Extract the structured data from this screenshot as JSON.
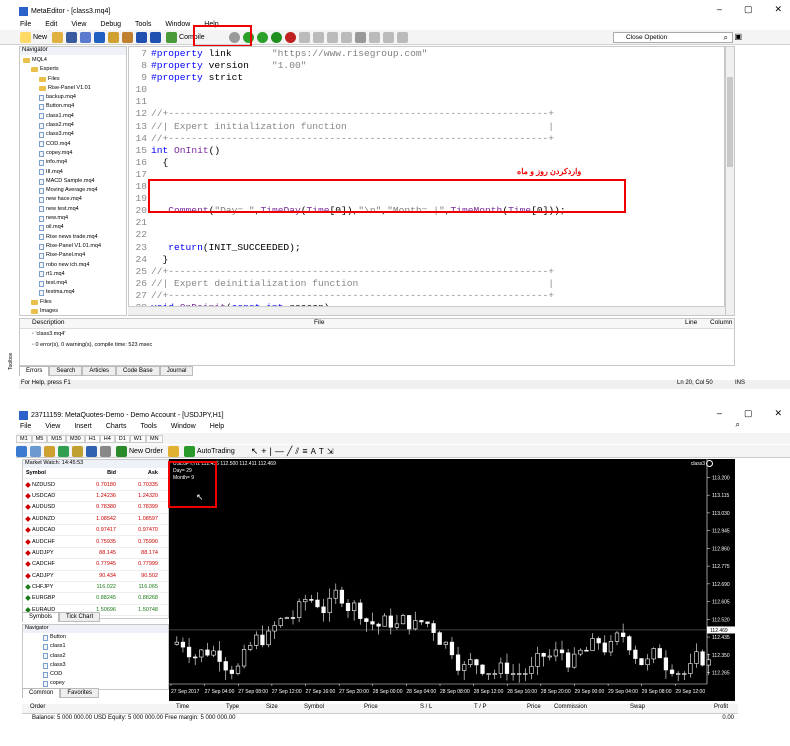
{
  "editor": {
    "title": "MetaEditor - [class3.mq4]",
    "menu": [
      "File",
      "Edit",
      "View",
      "Debug",
      "Tools",
      "Window",
      "Help"
    ],
    "toolbar": {
      "new_label": "New",
      "compile_label": "Compile",
      "search_value": "Close Opetion"
    },
    "navigator": {
      "header": "Navigator",
      "items": [
        {
          "label": "MQL4",
          "type": "folder",
          "indent": 0
        },
        {
          "label": "Experts",
          "type": "folder",
          "indent": 1
        },
        {
          "label": "Files",
          "type": "folder",
          "indent": 2
        },
        {
          "label": "Rise-Panel V1.01",
          "type": "folder",
          "indent": 2
        },
        {
          "label": "backup.mq4",
          "type": "file",
          "indent": 2
        },
        {
          "label": "Button.mq4",
          "type": "file",
          "indent": 2
        },
        {
          "label": "class1.mq4",
          "type": "file",
          "indent": 2
        },
        {
          "label": "class2.mq4",
          "type": "file",
          "indent": 2
        },
        {
          "label": "class3.mq4",
          "type": "file",
          "indent": 2
        },
        {
          "label": "COD.mq4",
          "type": "file",
          "indent": 2
        },
        {
          "label": "copey.mq4",
          "type": "file",
          "indent": 2
        },
        {
          "label": "info.mq4",
          "type": "file",
          "indent": 2
        },
        {
          "label": "III.mq4",
          "type": "file",
          "indent": 2
        },
        {
          "label": "MACD Sample.mq4",
          "type": "file",
          "indent": 2
        },
        {
          "label": "Moving Average.mq4",
          "type": "file",
          "indent": 2
        },
        {
          "label": "new hace.mq4",
          "type": "file",
          "indent": 2
        },
        {
          "label": "new test.mq4",
          "type": "file",
          "indent": 2
        },
        {
          "label": "new.mq4",
          "type": "file",
          "indent": 2
        },
        {
          "label": "oil.mq4",
          "type": "file",
          "indent": 2
        },
        {
          "label": "Rise news trade.mq4",
          "type": "file",
          "indent": 2
        },
        {
          "label": "Rise-Panel V1.01.mq4",
          "type": "file",
          "indent": 2
        },
        {
          "label": "Rise-Panel.mq4",
          "type": "file",
          "indent": 2
        },
        {
          "label": "robo new ich.mq4",
          "type": "file",
          "indent": 2
        },
        {
          "label": "rt1.mq4",
          "type": "file",
          "indent": 2
        },
        {
          "label": "test.mq4",
          "type": "file",
          "indent": 2
        },
        {
          "label": "testma.mq4",
          "type": "file",
          "indent": 2
        },
        {
          "label": "Files",
          "type": "folder",
          "indent": 1
        },
        {
          "label": "Images",
          "type": "folder",
          "indent": 1
        }
      ]
    },
    "code_lines": [
      {
        "n": "7",
        "html": "<span class='kw'>#property</span> link       <span class='st'>\"https://www.risegroup.com\"</span>"
      },
      {
        "n": "8",
        "html": "<span class='kw'>#property</span> version    <span class='st'>\"1.00\"</span>"
      },
      {
        "n": "9",
        "html": "<span class='kw'>#property</span> strict"
      },
      {
        "n": "10",
        "html": ""
      },
      {
        "n": "11",
        "html": ""
      },
      {
        "n": "12",
        "html": "<span class='cm'>//+------------------------------------------------------------------+</span>"
      },
      {
        "n": "13",
        "html": "<span class='cm'>//| Expert initialization function                                   |</span>"
      },
      {
        "n": "14",
        "html": "<span class='cm'>//+------------------------------------------------------------------+</span>"
      },
      {
        "n": "15",
        "html": "<span class='kw'>int</span> <span class='fn'>OnInit</span>()"
      },
      {
        "n": "16",
        "html": "  {"
      },
      {
        "n": "17",
        "html": ""
      },
      {
        "n": "18",
        "html": ""
      },
      {
        "n": "19",
        "html": ""
      },
      {
        "n": "20",
        "html": "   <span class='fn'>Comment</span>(<span class='st'>\"Day= \"</span>,<span class='fn'>TimeDay</span>(<span class='fn'>Time</span>[0]),<span class='st'>\"\\n\"</span>,<span class='st'>\"Month= |\"</span>,<span class='fn'>TimeMonth</span>(<span class='fn'>Time</span>[0]));"
      },
      {
        "n": "21",
        "html": ""
      },
      {
        "n": "22",
        "html": ""
      },
      {
        "n": "23",
        "html": "   <span class='kw'>return</span>(INIT_SUCCEEDED);"
      },
      {
        "n": "24",
        "html": "  }"
      },
      {
        "n": "25",
        "html": "<span class='cm'>//+------------------------------------------------------------------+</span>"
      },
      {
        "n": "26",
        "html": "<span class='cm'>//| Expert deinitialization function                                 |</span>"
      },
      {
        "n": "27",
        "html": "<span class='cm'>//+------------------------------------------------------------------+</span>"
      },
      {
        "n": "28",
        "html": "<span class='kw'>void</span> <span class='fn'>OnDeinit</span>(<span class='kw'>const int</span> reason)"
      },
      {
        "n": "29",
        "html": "  {"
      },
      {
        "n": "30",
        "html": "<span class='cm'>//---</span>"
      }
    ],
    "annotation_fa": "واردکردن روز و ماه",
    "errors_panel": {
      "col_description": "Description",
      "col_file": "File",
      "col_line": "Line",
      "col_column": "Column",
      "rows": [
        "'class3.mq4'",
        "0 error(s), 0 warning(s), compile time: 523 msec"
      ],
      "tabs": [
        "Errors",
        "Search",
        "Articles",
        "Code Base",
        "Journal"
      ],
      "side_label": "Toolbox"
    },
    "status": {
      "left": "For Help, press F1",
      "pos": "Ln 20, Col 50",
      "ins": "INS"
    }
  },
  "terminal": {
    "title": "23711159: MetaQuotes-Demo - Demo Account - [USDJPY,H1]",
    "menu": [
      "File",
      "View",
      "Insert",
      "Charts",
      "Tools",
      "Window",
      "Help"
    ],
    "timeframes": [
      "M1",
      "M5",
      "M15",
      "M30",
      "H1",
      "H4",
      "D1",
      "W1",
      "MN"
    ],
    "toolbar": {
      "new_order": "New Order",
      "autotrading": "AutoTrading"
    },
    "market_watch": {
      "header": "Market Watch: 14:45:53",
      "cols": [
        "Symbol",
        "Bid",
        "Ask"
      ],
      "rows": [
        {
          "s": "NZDUSD",
          "b": "0.70180",
          "a": "0.70335",
          "c": "#c00"
        },
        {
          "s": "USDCAD",
          "b": "1.24236",
          "a": "1.24320",
          "c": "#c00"
        },
        {
          "s": "AUDUSD",
          "b": "0.78380",
          "a": "0.78399",
          "c": "#c00"
        },
        {
          "s": "AUDNZD",
          "b": "1.08542",
          "a": "1.08597",
          "c": "#c00"
        },
        {
          "s": "AUDCAD",
          "b": "0.97417",
          "a": "0.97470",
          "c": "#c00"
        },
        {
          "s": "AUDCHF",
          "b": "0.75935",
          "a": "0.75990",
          "c": "#c00"
        },
        {
          "s": "AUDJPY",
          "b": "88.145",
          "a": "88.174",
          "c": "#c00"
        },
        {
          "s": "CADCHF",
          "b": "0.77945",
          "a": "0.77999",
          "c": "#c00"
        },
        {
          "s": "CADJPY",
          "b": "90.434",
          "a": "90.502",
          "c": "#c00"
        },
        {
          "s": "CHFJPY",
          "b": "116.022",
          "a": "116.065",
          "c": "#1a7a1a"
        },
        {
          "s": "EURGBP",
          "b": "0.88245",
          "a": "0.88268",
          "c": "#1a7a1a"
        },
        {
          "s": "EURAUD",
          "b": "1.50696",
          "a": "1.50748",
          "c": "#1a7a1a"
        }
      ],
      "tabs": [
        "Symbols",
        "Tick Chart"
      ]
    },
    "navigator": {
      "header": "Navigator",
      "items": [
        "Button",
        "class1",
        "class2",
        "class3",
        "COD",
        "copey"
      ],
      "tabs": [
        "Common",
        "Favorites"
      ]
    },
    "chart": {
      "header": "USDJPY,H1  112.436 112.500 112.411 112.469",
      "comment_day": "Day= 29",
      "comment_month": "Month= 9",
      "smiley_label": "class3",
      "yticks": [
        "113.200",
        "113.115",
        "113.030",
        "112.945",
        "112.860",
        "112.775",
        "112.690",
        "112.605",
        "112.520",
        "112.435",
        "112.350",
        "112.265"
      ],
      "xticks": [
        "27 Sep 2017",
        "27 Sep 04:00",
        "27 Sep 08:00",
        "27 Sep 12:00",
        "27 Sep 16:00",
        "27 Sep 20:00",
        "28 Sep 00:00",
        "28 Sep 04:00",
        "28 Sep 08:00",
        "28 Sep 12:00",
        "28 Sep 16:00",
        "28 Sep 20:00",
        "29 Sep 00:00",
        "29 Sep 04:00",
        "29 Sep 08:00",
        "29 Sep 12:00"
      ],
      "price_label": "112.469"
    },
    "trade_panel": {
      "cols": [
        "Order",
        "Time",
        "Type",
        "Size",
        "Symbol",
        "Price",
        "S / L",
        "T / P",
        "Price",
        "Commission",
        "Swap",
        "Profit"
      ],
      "balance": "Balance: 5 000 000.00 USD  Equity: 5 000 000.00  Free margin: 5 000 000.00",
      "total": "0.00"
    }
  }
}
